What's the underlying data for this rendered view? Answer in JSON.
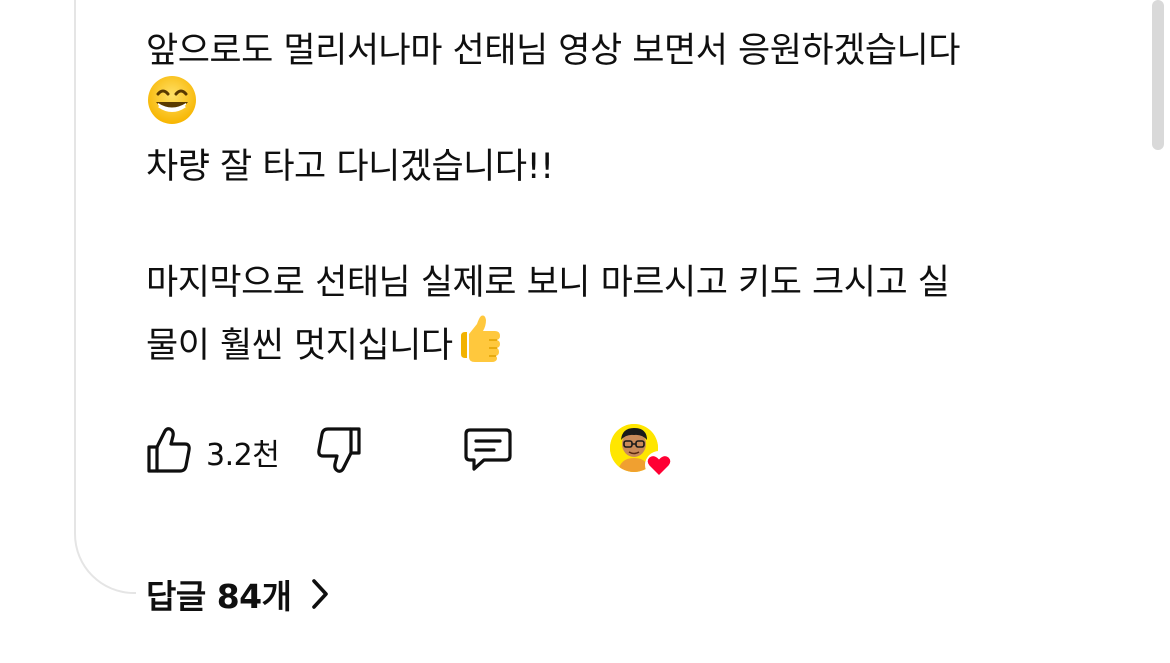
{
  "comment": {
    "line1": "앞으로도 멀리서나마 선태님 영상 보면서 응원하겠습니다",
    "line2": "차량 잘 타고 다니겠습니다!!",
    "line3": "마지막으로 선태님 실제로 보니 마르시고 키도 크시고 실",
    "line4": "물이 훨씬 멋지십니다"
  },
  "emojis": {
    "grin": "grinning-face-with-smiling-eyes-emoji",
    "thumbs_up": "thumbs-up-emoji"
  },
  "actions": {
    "like_count": "3.2천",
    "like_icon": "thumb-up-icon",
    "dislike_icon": "thumb-down-icon",
    "reply_icon": "comment-icon",
    "creator_heart_icon": "heart-icon"
  },
  "replies": {
    "label": "답글 84개",
    "chevron_icon": "chevron-right-icon"
  },
  "colors": {
    "text": "#0f0f0f",
    "divider": "#e5e5e5",
    "heart": "#ff0033",
    "avatar_bg": "#ffe600"
  }
}
